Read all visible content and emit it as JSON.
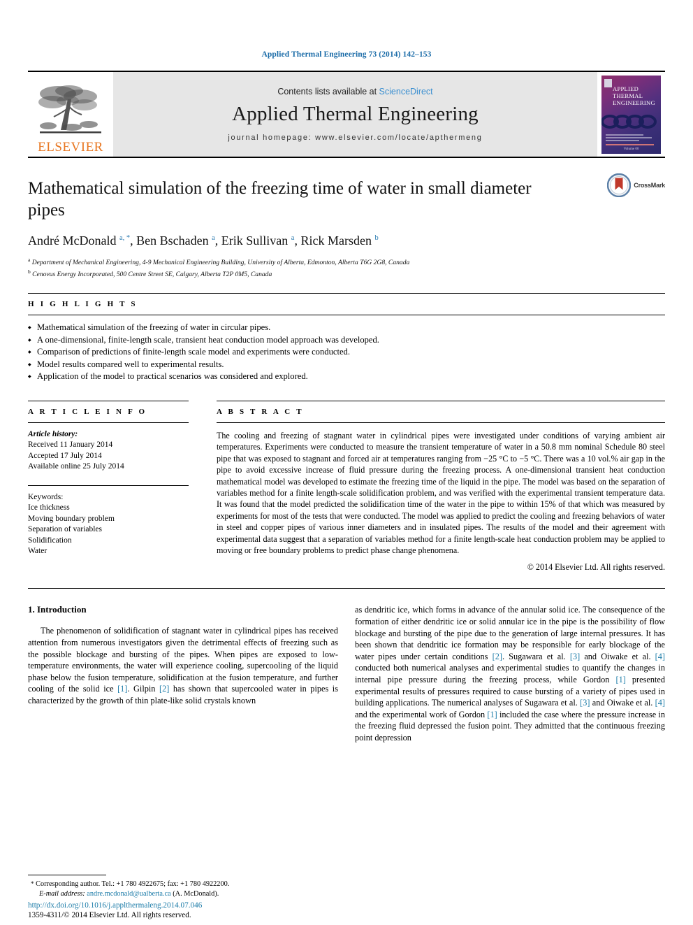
{
  "running_head": "Applied Thermal Engineering 73 (2014) 142–153",
  "masthead": {
    "publisher_name": "ELSEVIER",
    "contents_prefix": "Contents lists available at ",
    "sciencedirect": "ScienceDirect",
    "journal_name": "Applied Thermal Engineering",
    "homepage": "journal homepage: www.elsevier.com/locate/apthermeng",
    "cover": {
      "line1": "APPLIED",
      "line2": "THERMAL",
      "line3": "ENGINEERING",
      "footer": "Volume 00"
    },
    "colors": {
      "link_blue": "#3a8fd0",
      "elsevier_orange": "#e87722",
      "band_gray": "#e6e6e6"
    }
  },
  "article": {
    "title": "Mathematical simulation of the freezing time of water in small diameter pipes",
    "crossmark_label": "CrossMark",
    "authors_html": "André McDonald <sup>a, *</sup>, Ben Bschaden <sup>a</sup>, Erik Sullivan <sup>a</sup>, Rick Marsden <sup>b</sup>",
    "affiliations": [
      "Department of Mechanical Engineering, 4-9 Mechanical Engineering Building, University of Alberta, Edmonton, Alberta T6G 2G8, Canada",
      "Cenovus Energy Incorporated, 500 Centre Street SE, Calgary, Alberta T2P 0M5, Canada"
    ]
  },
  "highlights": {
    "heading": "H I G H L I G H T S",
    "items": [
      "Mathematical simulation of the freezing of water in circular pipes.",
      "A one-dimensional, finite-length scale, transient heat conduction model approach was developed.",
      "Comparison of predictions of finite-length scale model and experiments were conducted.",
      "Model results compared well to experimental results.",
      "Application of the model to practical scenarios was considered and explored."
    ]
  },
  "article_info": {
    "heading": "A R T I C L E   I N F O",
    "history_label": "Article history:",
    "history": [
      "Received 11 January 2014",
      "Accepted 17 July 2014",
      "Available online 25 July 2014"
    ],
    "keywords_label": "Keywords:",
    "keywords": [
      "Ice thickness",
      "Moving boundary problem",
      "Separation of variables",
      "Solidification",
      "Water"
    ]
  },
  "abstract": {
    "heading": "A B S T R A C T",
    "text": "The cooling and freezing of stagnant water in cylindrical pipes were investigated under conditions of varying ambient air temperatures. Experiments were conducted to measure the transient temperature of water in a 50.8 mm nominal Schedule 80 steel pipe that was exposed to stagnant and forced air at temperatures ranging from −25 °C to −5 °C. There was a 10 vol.% air gap in the pipe to avoid excessive increase of fluid pressure during the freezing process. A one-dimensional transient heat conduction mathematical model was developed to estimate the freezing time of the liquid in the pipe. The model was based on the separation of variables method for a finite length-scale solidification problem, and was verified with the experimental transient temperature data. It was found that the model predicted the solidification time of the water in the pipe to within 15% of that which was measured by experiments for most of the tests that were conducted. The model was applied to predict the cooling and freezing behaviors of water in steel and copper pipes of various inner diameters and in insulated pipes. The results of the model and their agreement with experimental data suggest that a separation of variables method for a finite length-scale heat conduction problem may be applied to moving or free boundary problems to predict phase change phenomena.",
    "copyright": "© 2014 Elsevier Ltd. All rights reserved."
  },
  "introduction": {
    "number_title": "1. Introduction",
    "left_paragraph_html": "The phenomenon of solidification of stagnant water in cylindrical pipes has received attention from numerous investigators given the detrimental effects of freezing such as the possible blockage and bursting of the pipes. When pipes are exposed to low-temperature environments, the water will experience cooling, supercooling of the liquid phase below the fusion temperature, solidification at the fusion temperature, and further cooling of the solid ice <span class=\"ref\">[1]</span>. Gilpin <span class=\"ref\">[2]</span> has shown that supercooled water in pipes is characterized by the growth of thin plate-like solid crystals known",
    "right_paragraph_html": "as dendritic ice, which forms in advance of the annular solid ice. The consequence of the formation of either dendritic ice or solid annular ice in the pipe is the possibility of flow blockage and bursting of the pipe due to the generation of large internal pressures. It has been shown that dendritic ice formation may be responsible for early blockage of the water pipes under certain conditions <span class=\"ref\">[2]</span>. Sugawara et al. <span class=\"ref\">[3]</span> and Oiwake et al. <span class=\"ref\">[4]</span> conducted both numerical analyses and experimental studies to quantify the changes in internal pipe pressure during the freezing process, while Gordon <span class=\"ref\">[1]</span> presented experimental results of pressures required to cause bursting of a variety of pipes used in building applications. The numerical analyses of Sugawara et al. <span class=\"ref\">[3]</span> and Oiwake et al. <span class=\"ref\">[4]</span> and the experimental work of Gordon <span class=\"ref\">[1]</span> included the case where the pressure increase in the freezing fluid depressed the fusion point. They admitted that the continuous freezing point depression"
  },
  "footer": {
    "corresponding_html": "<span class=\"star\">*</span> Corresponding author. Tel.: +1 780 4922675; fax: +1 780 4922200.",
    "email_label": "E-mail address:",
    "email": "andre.mcdonald@ualberta.ca",
    "email_suffix": "(A. McDonald).",
    "doi": "http://dx.doi.org/10.1016/j.applthermaleng.2014.07.046",
    "issn_line": "1359-4311/© 2014 Elsevier Ltd. All rights reserved."
  }
}
